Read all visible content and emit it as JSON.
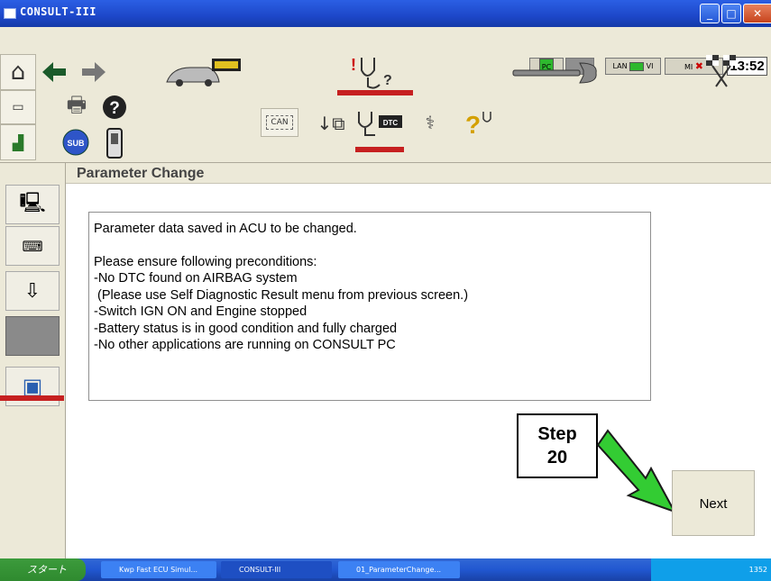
{
  "window": {
    "title": "CONSULT-III"
  },
  "status": {
    "pc": "PC",
    "lan": "LAN",
    "vi": "VI",
    "mi": "MI",
    "time": "13:52"
  },
  "icons": {
    "home": "home-icon",
    "back": "back-arrow-icon",
    "forward": "forward-arrow-icon",
    "vehicle_ecu": "vehicle-ecu-icon",
    "diagnosis": "diagnosis-stethoscope-icon",
    "wrench": "wrench-icon",
    "flags": "checkered-flags-icon",
    "print": "printer-icon",
    "help": "help-icon",
    "sub": "SUB",
    "dtc": "DTC",
    "can": "CAN"
  },
  "page": {
    "heading": "Parameter Change"
  },
  "message": {
    "line1": "Parameter data saved in ACU to be changed.",
    "line2": "Please ensure following preconditions:",
    "line3": "-No DTC found on AIRBAG system",
    "line4": " (Please use Self Diagnostic Result menu from previous screen.)",
    "line5": "-Switch IGN ON and Engine stopped",
    "line6": "-Battery status is in good condition and fully charged",
    "line7": "-No other applications are running on CONSULT PC"
  },
  "annotation": {
    "step_word": "Step",
    "step_number": "20"
  },
  "buttons": {
    "next": "Next"
  },
  "taskbar": {
    "start": "スタート",
    "task1": "Kwp Fast ECU Simul...",
    "task2": "CONSULT-III",
    "task3": "01_ParameterChange...",
    "clock": "1352"
  },
  "colors": {
    "accent_red": "#c62020",
    "arrow_green": "#33cc33",
    "title_blue": "#1d47c9"
  }
}
